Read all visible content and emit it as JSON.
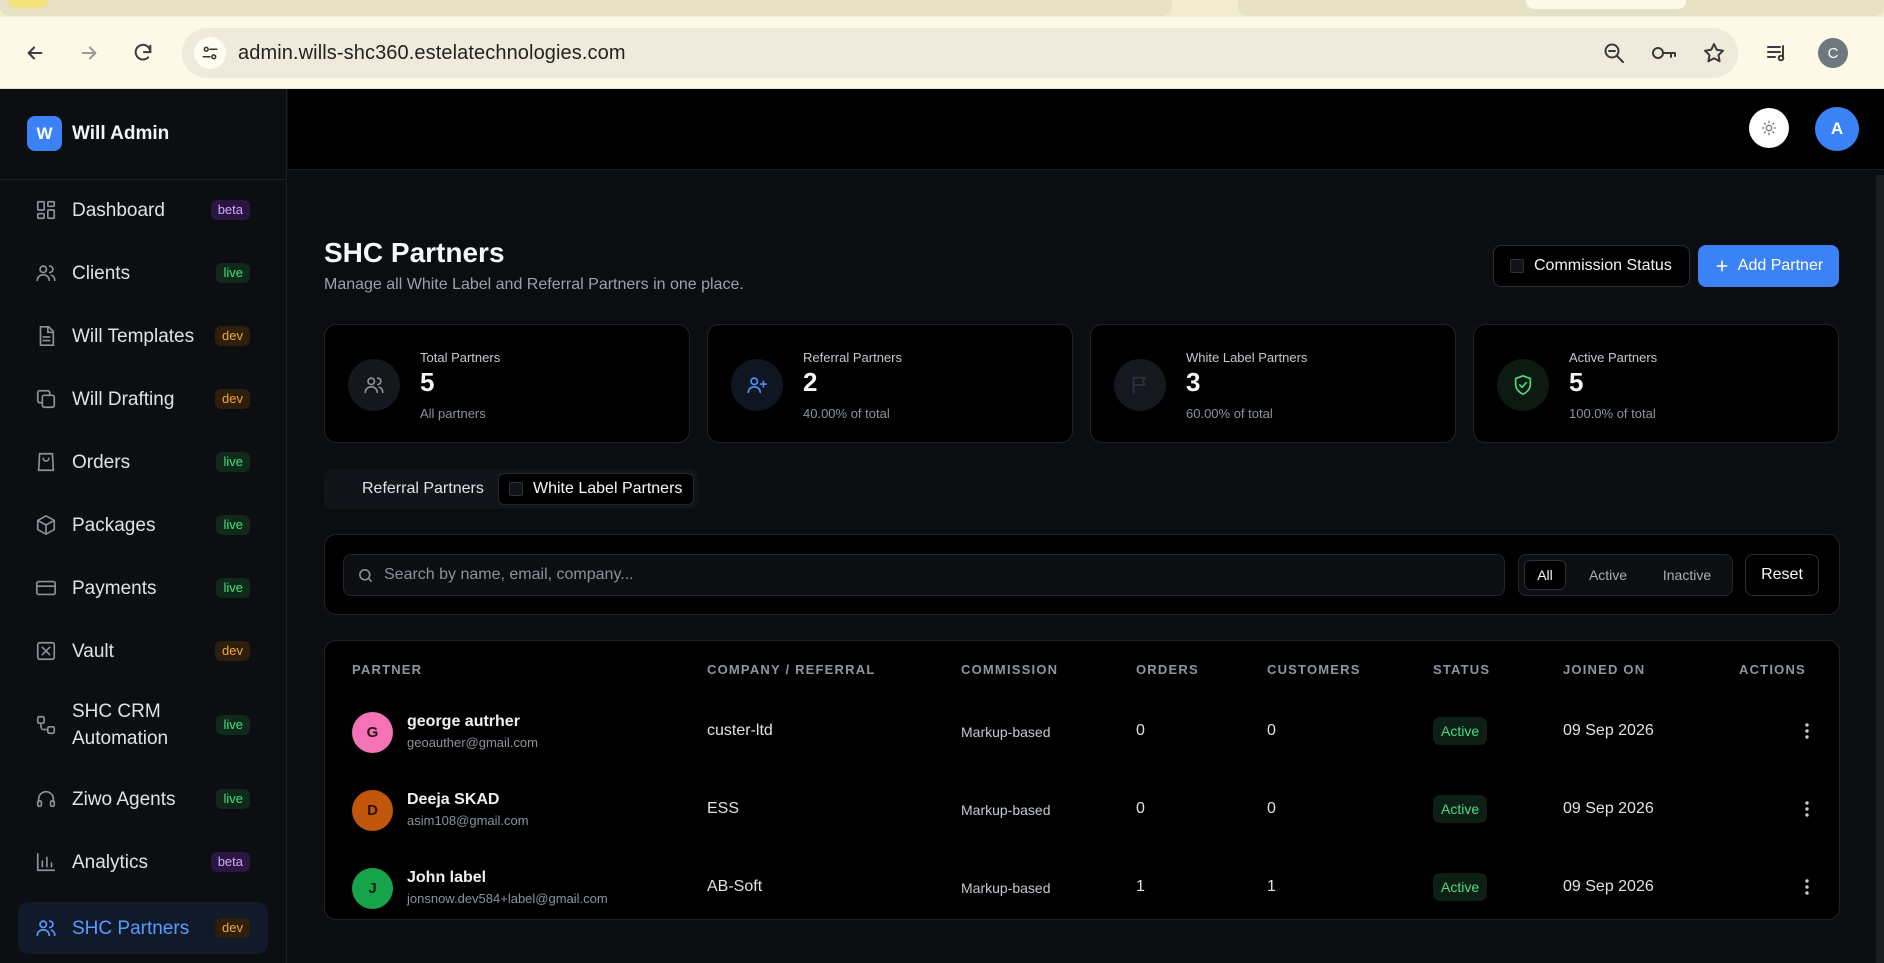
{
  "browser": {
    "url": "admin.wills-shc360.estelatechnologies.com",
    "profile_initial": "C"
  },
  "sidebar": {
    "brand_logo": "W",
    "brand_name": "Will Admin",
    "items": [
      {
        "label": "Dashboard",
        "badge": "beta",
        "icon": "dashboard-icon"
      },
      {
        "label": "Clients",
        "badge": "live",
        "icon": "users-icon"
      },
      {
        "label": "Will Templates",
        "badge": "dev",
        "icon": "document-icon"
      },
      {
        "label": "Will Drafting",
        "badge": "dev",
        "icon": "copy-icon"
      },
      {
        "label": "Orders",
        "badge": "live",
        "icon": "bag-icon"
      },
      {
        "label": "Packages",
        "badge": "live",
        "icon": "package-icon"
      },
      {
        "label": "Payments",
        "badge": "live",
        "icon": "card-icon"
      },
      {
        "label": "Vault",
        "badge": "dev",
        "icon": "vault-icon"
      },
      {
        "label": "SHC CRM Automation",
        "badge": "live",
        "icon": "workflow-icon"
      },
      {
        "label": "Ziwo Agents",
        "badge": "live",
        "icon": "headset-icon"
      },
      {
        "label": "Analytics",
        "badge": "beta",
        "icon": "chart-icon"
      },
      {
        "label": "SHC Partners",
        "badge": "dev",
        "icon": "partners-icon"
      }
    ]
  },
  "topbar": {
    "avatar_initial": "A"
  },
  "page": {
    "title": "SHC Partners",
    "subtitle": "Manage all White Label and Referral Partners in one place.",
    "commission_button": "Commission Status",
    "add_button": "Add Partner"
  },
  "stats": [
    {
      "label": "Total Partners",
      "value": "5",
      "note": "All partners"
    },
    {
      "label": "Referral Partners",
      "value": "2",
      "note": "40.00% of total"
    },
    {
      "label": "White Label Partners",
      "value": "3",
      "note": "60.00% of total"
    },
    {
      "label": "Active Partners",
      "value": "5",
      "note": "100.0% of total"
    }
  ],
  "tabs": {
    "referral": "Referral Partners",
    "white_label": "White Label Partners"
  },
  "filters": {
    "search_placeholder": "Search by name, email, company...",
    "all": "All",
    "active": "Active",
    "inactive": "Inactive",
    "reset": "Reset"
  },
  "table": {
    "headers": [
      "PARTNER",
      "COMPANY / REFERRAL",
      "COMMISSION",
      "ORDERS",
      "CUSTOMERS",
      "STATUS",
      "JOINED ON",
      "ACTIONS"
    ],
    "rows": [
      {
        "initial": "G",
        "name": "george autrher",
        "email": "geoauther@gmail.com",
        "company": "custer-ltd",
        "commission": "Markup-based",
        "orders": "0",
        "customers": "0",
        "status": "Active",
        "joined": "09 Sep 2026",
        "avatar_color": "#f472b6"
      },
      {
        "initial": "D",
        "name": "Deeja SKAD",
        "email": "asim108@gmail.com",
        "company": "ESS",
        "commission": "Markup-based",
        "orders": "0",
        "customers": "0",
        "status": "Active",
        "joined": "09 Sep 2026",
        "avatar_color": "#c2570c"
      },
      {
        "initial": "J",
        "name": "John label",
        "email": "jonsnow.dev584+label@gmail.com",
        "company": "AB-Soft",
        "commission": "Markup-based",
        "orders": "1",
        "customers": "1",
        "status": "Active",
        "joined": "09 Sep 2026",
        "avatar_color": "#16a34a"
      }
    ]
  },
  "colors": {
    "accent": "#3a82f6",
    "success": "#4ade80",
    "beta": "#d3a6ff",
    "dev": "#f6a53a"
  }
}
